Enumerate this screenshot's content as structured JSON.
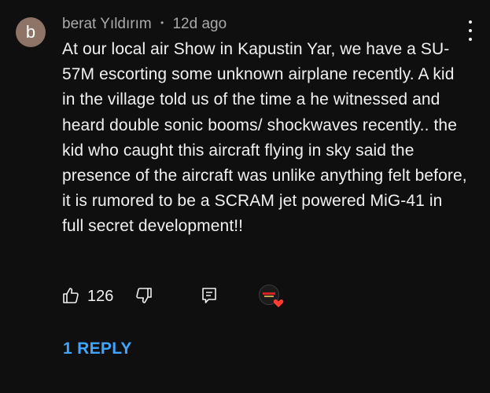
{
  "comment": {
    "avatar_letter": "b",
    "author": "berat Yıldırım",
    "separator": "•",
    "timestamp": "12d ago",
    "text": "At our local air Show in Kapustin Yar, we have a SU-57M escorting some unknown airplane recently. A kid in the village told us of the time a he witnessed and heard double sonic booms/ shockwaves recently.. the kid who caught this aircraft flying in sky said the presence of the aircraft was unlike anything felt before, it is rumored to be a SCRAM jet powered MiG-41 in full secret development!!",
    "like_count": "126",
    "replies_label": "1 REPLY"
  },
  "icons": {
    "more": "more-vertical-icon",
    "like": "thumbs-up-icon",
    "dislike": "thumbs-down-icon",
    "reply": "reply-icon",
    "creator_heart": "creator-heart-icon"
  },
  "colors": {
    "background": "#0f0f0f",
    "avatar": "#8d7466",
    "meta_text": "#aaaaaa",
    "body_text": "#f1f1f1",
    "link": "#3ea6ff",
    "heart": "#ff3b30"
  }
}
